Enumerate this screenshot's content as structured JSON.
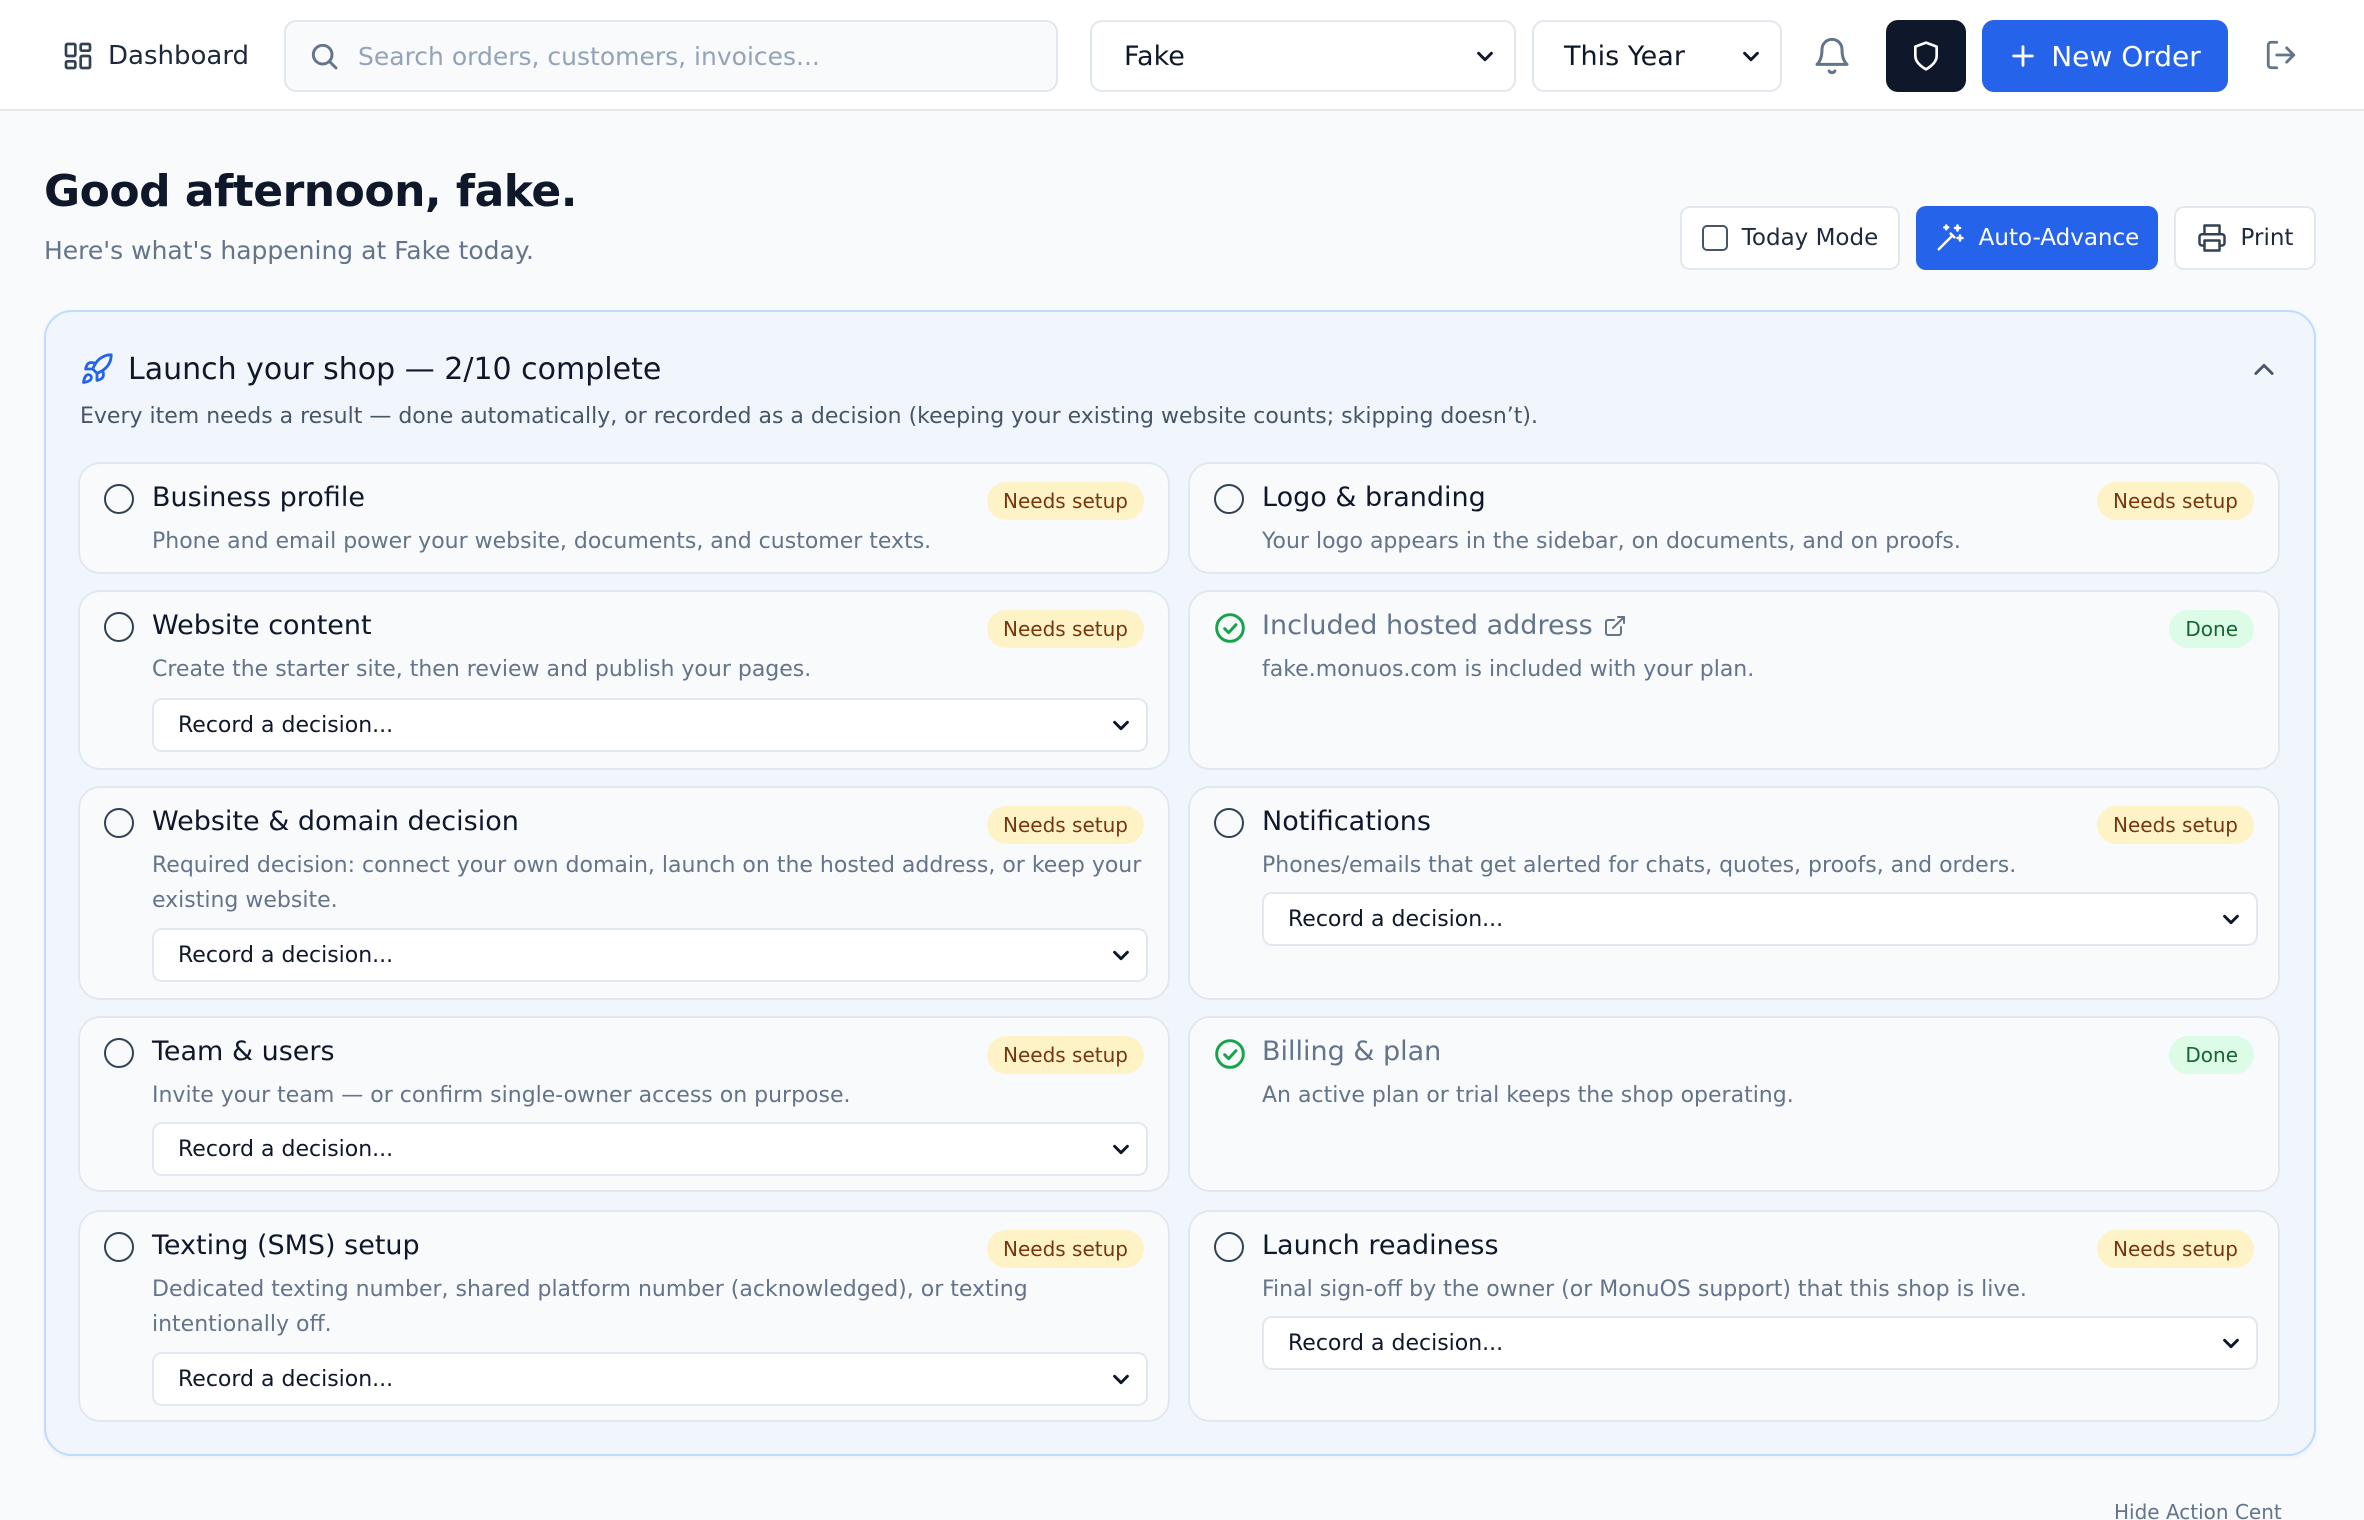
{
  "topbar": {
    "dashboard_label": "Dashboard",
    "search_placeholder": "Search orders, customers, invoices...",
    "shop_select": "Fake",
    "period_select": "This Year",
    "new_order_label": "New Order"
  },
  "header": {
    "greeting": "Good afternoon, fake.",
    "subtitle": "Here's what's happening at Fake today.",
    "today_mode_label": "Today Mode",
    "auto_advance_label": "Auto-Advance",
    "print_label": "Print"
  },
  "launch": {
    "title": "Launch your shop — 2/10 complete",
    "description": "Every item needs a result — done automatically, or recorded as a decision (keeping your existing website counts; skipping doesn’t).",
    "decision_placeholder": "Record a decision...",
    "items": [
      {
        "title": "Business profile",
        "desc": "Phone and email power your website, documents, and customer texts.",
        "status": "Needs setup"
      },
      {
        "title": "Logo & branding",
        "desc": "Your logo appears in the sidebar, on documents, and on proofs.",
        "status": "Needs setup"
      },
      {
        "title": "Website content",
        "desc": "Create the starter site, then review and publish your pages.",
        "status": "Needs setup"
      },
      {
        "title": "Included hosted address",
        "desc": "fake.monuos.com is included with your plan.",
        "status": "Done"
      },
      {
        "title": "Website & domain decision",
        "desc": "Required decision: connect your own domain, launch on the hosted address, or keep your existing website.",
        "status": "Needs setup"
      },
      {
        "title": "Notifications",
        "desc": "Phones/emails that get alerted for chats, quotes, proofs, and orders.",
        "status": "Needs setup"
      },
      {
        "title": "Team & users",
        "desc": "Invite your team — or confirm single-owner access on purpose.",
        "status": "Needs setup"
      },
      {
        "title": "Billing & plan",
        "desc": "An active plan or trial keeps the shop operating.",
        "status": "Done"
      },
      {
        "title": "Texting (SMS) setup",
        "desc": "Dedicated texting number, shared platform number (acknowledged), or texting intentionally off.",
        "status": "Needs setup"
      },
      {
        "title": "Launch readiness",
        "desc": "Final sign-off by the owner (or MonuOS support) that this shop is live.",
        "status": "Needs setup"
      }
    ]
  },
  "footer": {
    "hide_action_center": "Hide Action Cent"
  }
}
